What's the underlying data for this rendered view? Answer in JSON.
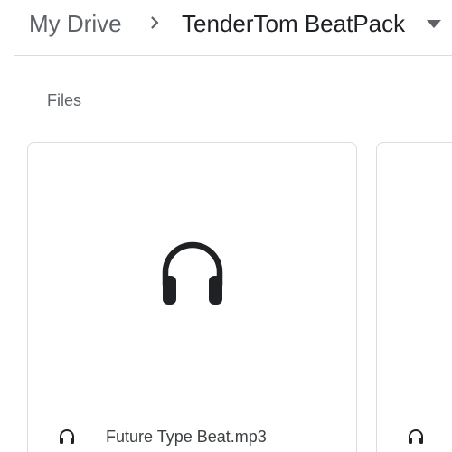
{
  "breadcrumb": {
    "root": "My Drive",
    "current": "TenderTom BeatPack",
    "separator_icon": "chevron-right-icon",
    "dropdown_icon": "caret-down-icon"
  },
  "section": {
    "title": "Files"
  },
  "files": [
    {
      "name": "Future Type Beat.mp3",
      "type_icon": "headphones-icon"
    },
    {
      "name": "",
      "type_icon": "headphones-icon"
    }
  ],
  "colors": {
    "text_primary": "#202124",
    "text_secondary": "#5f6368",
    "border": "#dadce0",
    "icon": "#202124"
  }
}
